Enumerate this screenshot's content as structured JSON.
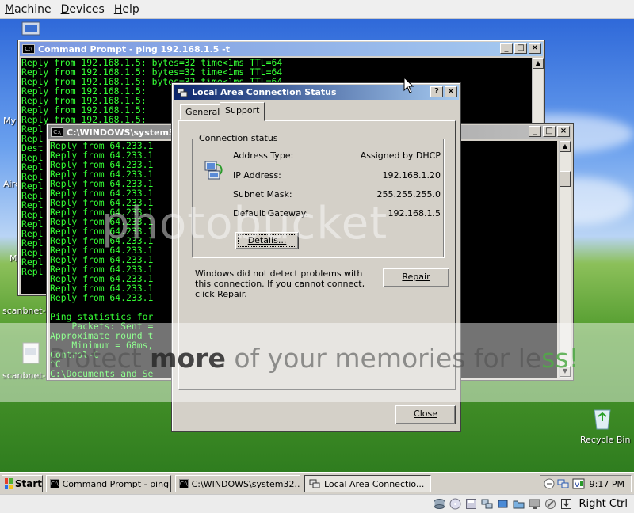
{
  "host_menu": [
    "Machine",
    "Devices",
    "Help"
  ],
  "desktop": {
    "icons": [
      {
        "label": "scanbnet-0"
      },
      {
        "label": "scanbnet-0"
      },
      {
        "label": "Recycle Bin"
      }
    ],
    "edge_labels": [
      "My",
      "Airc",
      "M"
    ]
  },
  "ping_window": {
    "title": "Command Prompt - ping 192.168.1.5 -t",
    "lines": [
      "Reply from 192.168.1.5: bytes=32 time<1ms TTL=64",
      "Reply from 192.168.1.5: bytes=32 time<1ms TTL=64",
      "Reply from 192.168.1.5: bytes=32 time<1ms TTL=64",
      "Reply from 192.168.1.5:",
      "Reply from 192.168.1.5:",
      "Reply from 192.168.1.5:",
      "Reply from 192.168.1.5:",
      "Repl",
      "Repl",
      "Dest",
      "Repl",
      "Repl",
      "Repl",
      "Repl",
      "Repl",
      "Repl",
      "Repl",
      "Repl",
      "Repl",
      "Repl",
      "Repl",
      "Repl",
      "Repl"
    ]
  },
  "second_window": {
    "title": "C:\\WINDOWS\\system32",
    "lines": [
      "Reply from 64.233.1",
      "Reply from 64.233.1",
      "Reply from 64.233.1",
      "Reply from 64.233.1",
      "Reply from 64.233.1",
      "Reply from 64.233.1",
      "Reply from 64.233.1",
      "Reply from 64.233.1",
      "Reply from 64.233.1",
      "Reply from 64.233.1",
      "Reply from 64.233.1",
      "Reply from 64.233.1",
      "Reply from 64.233.1",
      "Reply from 64.233.1",
      "Reply from 64.233.1",
      "Reply from 64.233.1",
      "Reply from 64.233.1",
      "",
      "Ping statistics for",
      "    Packets: Sent =",
      "Approximate round t",
      "    Minimum = 68ms,",
      "Control-C",
      "^C",
      "C:\\Documents and Se"
    ]
  },
  "dialog": {
    "title": "Local Area Connection Status",
    "help_btn": "?",
    "close_btn": "×",
    "tabs": [
      "General",
      "Support"
    ],
    "selected_tab": "Support",
    "group_label": "Connection status",
    "fields": [
      {
        "label": "Address Type:",
        "value": "Assigned by DHCP"
      },
      {
        "label": "IP Address:",
        "value": "192.168.1.20"
      },
      {
        "label": "Subnet Mask:",
        "value": "255.255.255.0"
      },
      {
        "label": "Default Gateway:",
        "value": "192.168.1.5"
      }
    ],
    "details_label": "Details...",
    "info_text": "Windows did not detect problems with this connection. If you cannot connect, click Repair.",
    "repair_label": "Repair",
    "close_label": "Close"
  },
  "taskbar": {
    "start_label": "Start",
    "tasks": [
      {
        "label": "Command Prompt - ping ...",
        "active": false
      },
      {
        "label": "C:\\WINDOWS\\system32...",
        "active": false
      },
      {
        "label": "Local Area Connectio...",
        "active": true
      }
    ],
    "clock": "9:17 PM"
  },
  "host_status": {
    "host_key": "Right Ctrl"
  },
  "watermark": {
    "brand": "photobucket",
    "slogan_a": "Protect ",
    "slogan_b": "more",
    "slogan_c": " of your memories for le",
    "slogan_d": "ss!"
  },
  "colors": {
    "console_text": "#35ff35",
    "titlebar_active": "#0a246a",
    "titlebar_inactive": "#7a96df"
  }
}
